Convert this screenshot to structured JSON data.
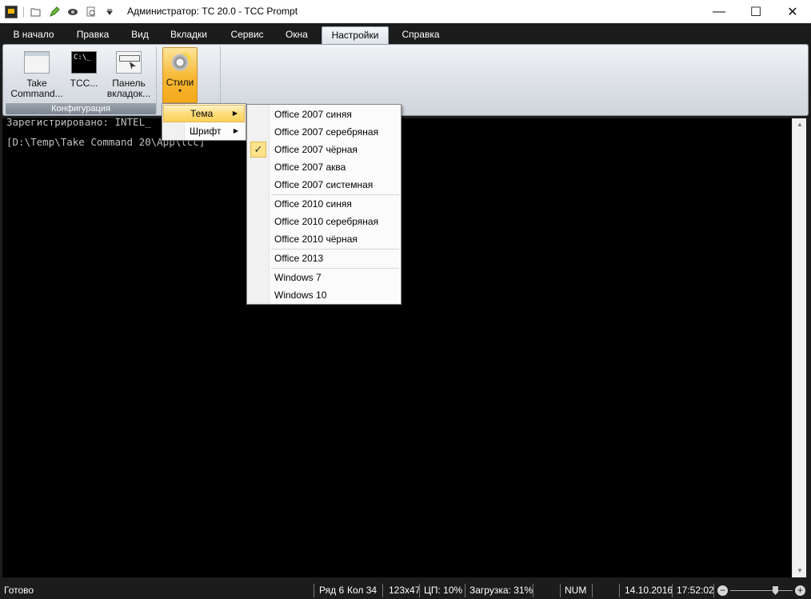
{
  "window": {
    "title": "Администратор: TC 20.0 - TCC Prompt",
    "minimize_glyph": "—",
    "maximize_glyph": "☐",
    "close_glyph": "✕"
  },
  "quick_access": [
    {
      "name": "app-icon"
    },
    {
      "name": "open-folder-icon"
    },
    {
      "name": "edit-icon"
    },
    {
      "name": "view-icon"
    },
    {
      "name": "search-icon"
    },
    {
      "name": "customize-qat-icon"
    }
  ],
  "tabs": [
    {
      "label": "В начало"
    },
    {
      "label": "Правка"
    },
    {
      "label": "Вид"
    },
    {
      "label": "Вкладки"
    },
    {
      "label": "Сервис"
    },
    {
      "label": "Окна"
    },
    {
      "label": "Настройки"
    },
    {
      "label": "Справка"
    }
  ],
  "ribbon": {
    "group_config": {
      "label": "Конфигурация",
      "buttons": [
        {
          "line1": "Take",
          "line2": "Command..."
        },
        {
          "line1": "TCC...",
          "line2": "",
          "icon_text": "C:\\_"
        },
        {
          "line1": "Панель",
          "line2": "вкладок..."
        }
      ]
    },
    "styles_button": {
      "label": "Стили",
      "arrow": "▾"
    }
  },
  "console": {
    "lines": [
      "Зарегистрировано: INTEL_",
      "[D:\\Temp\\Take Command 20\\App\\tcc]"
    ]
  },
  "styles_menu": {
    "items": [
      {
        "label": "Тема",
        "submenu_arrow": "▶"
      },
      {
        "label": "Шрифт",
        "submenu_arrow": "▶"
      }
    ]
  },
  "theme_menu": {
    "check_glyph": "✓",
    "groups": [
      [
        "Office 2007 синяя",
        "Office 2007 серебряная",
        "Office 2007 чёрная",
        "Office 2007 аква",
        "Office 2007 системная"
      ],
      [
        "Office 2010 синяя",
        "Office 2010 серебряная",
        "Office 2010 чёрная"
      ],
      [
        "Office 2013"
      ],
      [
        "Windows 7",
        "Windows 10"
      ]
    ],
    "checked": "Office 2007 чёрная"
  },
  "status_bar": {
    "ready": "Готово",
    "row": "Ряд 6",
    "col": "Кол 34",
    "size": "123x47",
    "cpu": "ЦП: 10%",
    "load": "Загрузка: 31%",
    "num": "NUM",
    "date": "14.10.2016",
    "time": "17:52:02",
    "zoom_out": "−",
    "zoom_in": "+"
  }
}
